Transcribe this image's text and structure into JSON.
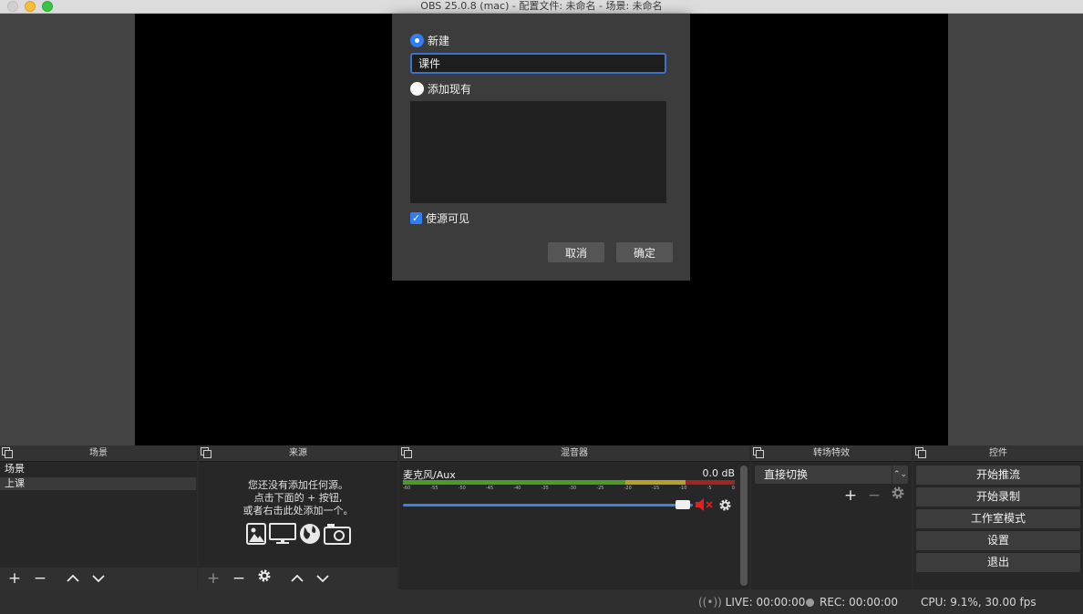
{
  "window": {
    "title": "OBS 25.0.8 (mac) - 配置文件: 未命名 - 场景: 未命名"
  },
  "dialog": {
    "new_label": "新建",
    "name_value": "课件",
    "add_existing_label": "添加现有",
    "make_visible_label": "使源可见",
    "cancel_label": "取消",
    "ok_label": "确定"
  },
  "docks": {
    "scenes": {
      "title": "场景",
      "items": [
        "场景",
        "上课"
      ]
    },
    "sources": {
      "title": "来源",
      "empty_line1": "您还没有添加任何源。",
      "empty_line2": "点击下面的 + 按钮,",
      "empty_line3": "或者右击此处添加一个。"
    },
    "mixer": {
      "title": "混音器",
      "channel_name": "麦克风/Aux",
      "channel_db": "0.0 dB",
      "ticks": [
        "-60",
        "-55",
        "-50",
        "-45",
        "-40",
        "-35",
        "-30",
        "-25",
        "-20",
        "-15",
        "-10",
        "-5",
        "0"
      ],
      "volume_fraction": 1.0
    },
    "transitions": {
      "title": "转场特效",
      "selected": "直接切换"
    },
    "controls": {
      "title": "控件",
      "buttons": [
        "开始推流",
        "开始录制",
        "工作室模式",
        "设置",
        "退出"
      ]
    }
  },
  "status": {
    "live": "LIVE: 00:00:00",
    "rec": "REC: 00:00:00",
    "cpu": "CPU: 9.1%, 30.00 fps"
  },
  "colors": {
    "accent": "#2f7ef3",
    "meter_green": "#4c9a2a",
    "meter_yellow": "#b3a12c",
    "meter_red": "#a02424",
    "mute_red": "#e02020"
  }
}
